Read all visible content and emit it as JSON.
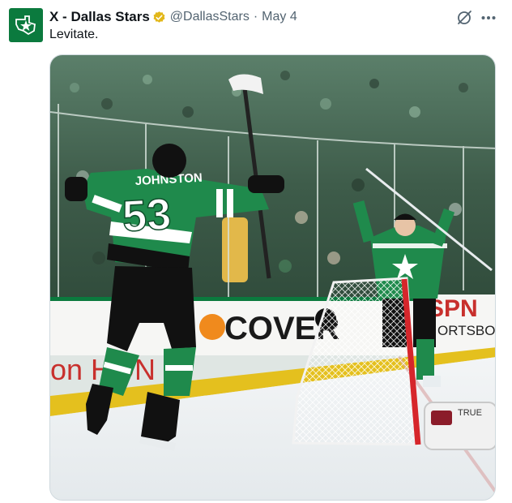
{
  "tweet": {
    "author_name": "X - Dallas Stars",
    "handle": "@DallasStars",
    "separator": "·",
    "date": "May 4",
    "text": "Levitate."
  },
  "icons": {
    "avatar": "dallas-stars-logo",
    "verified": "verified-badge-icon",
    "grok": "grok-icon",
    "more": "more-icon"
  },
  "colors": {
    "brand_green": "#0b7a3e",
    "verified_gold": "#e2b719",
    "secondary_text": "#536471",
    "jersey_green": "#1f8a4c"
  },
  "photo": {
    "jersey_name": "JOHNSTON",
    "jersey_number": "53",
    "board_ad_left": "on HON",
    "board_ad_center": "COVER",
    "board_ad_right_top": "SPN",
    "board_ad_right_bottom": "ORTSBO",
    "stick_brand": "TRUE"
  }
}
